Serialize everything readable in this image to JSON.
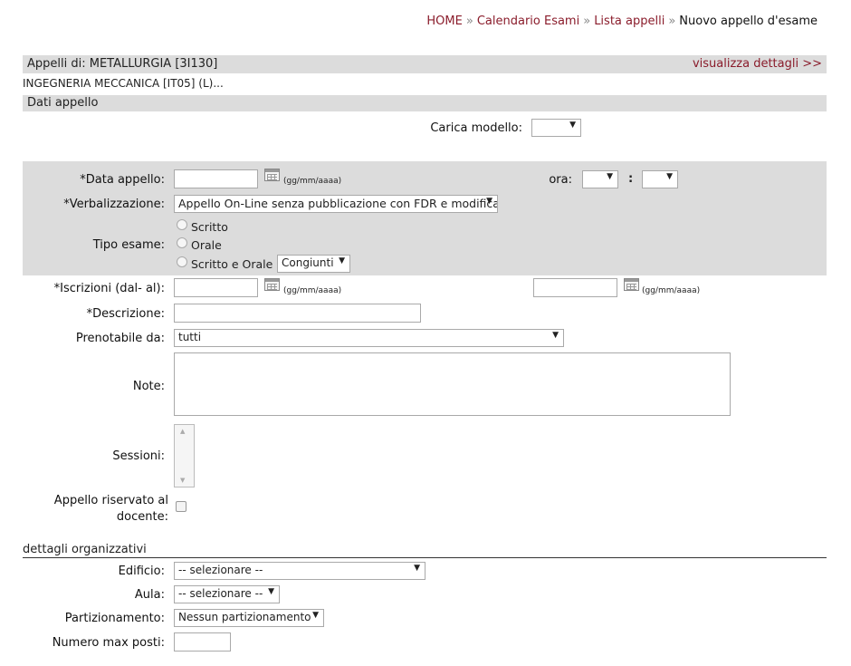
{
  "breadcrumb": {
    "home": "HOME",
    "calendar": "Calendario Esami",
    "list": "Lista appelli",
    "current": "Nuovo appello d'esame",
    "separator": "»"
  },
  "header": {
    "title": "Appelli di: METALLURGIA [3I130]",
    "details_link": "visualizza dettagli >>",
    "subtitle": "INGEGNERIA MECCANICA [IT05] (L)..."
  },
  "section_dati": "Dati appello",
  "carica_modello": {
    "label": "Carica modello:",
    "value": ""
  },
  "data_appello": {
    "label": "*Data appello:",
    "value": "",
    "format": "(gg/mm/aaaa)"
  },
  "ora": {
    "label": "ora:",
    "sep": ":",
    "hour": "",
    "minute": ""
  },
  "verbalizzazione": {
    "label": "*Verbalizzazione:",
    "value": "Appello On-Line senza pubblicazione con FDR e modifica"
  },
  "tipo_esame": {
    "label": "Tipo esame:",
    "options": [
      "Scritto",
      "Orale",
      "Scritto e Orale"
    ],
    "mode": "Congiunti"
  },
  "iscrizioni": {
    "label": "*Iscrizioni (dal- al):",
    "from": "",
    "to": "",
    "format": "(gg/mm/aaaa)"
  },
  "descrizione": {
    "label": "*Descrizione:",
    "value": ""
  },
  "prenotabile": {
    "label": "Prenotabile da:",
    "value": "tutti"
  },
  "note": {
    "label": "Note:",
    "value": ""
  },
  "sessioni": {
    "label": "Sessioni:"
  },
  "riservato": {
    "label_line1": "Appello riservato al",
    "label_line2": "docente:"
  },
  "section_org": "dettagli organizzativi",
  "edificio": {
    "label": "Edificio:",
    "value": "-- selezionare --"
  },
  "aula": {
    "label": "Aula:",
    "value": "-- selezionare --"
  },
  "partizionamento": {
    "label": "Partizionamento:",
    "value": "Nessun partizionamento"
  },
  "max_posti": {
    "label": "Numero max posti:",
    "value": ""
  }
}
